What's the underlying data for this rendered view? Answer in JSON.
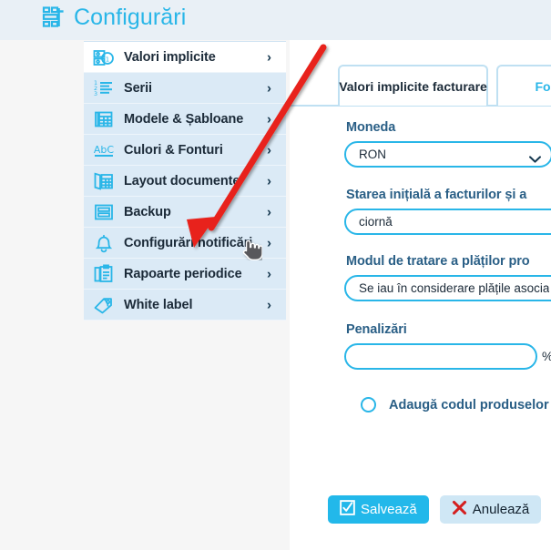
{
  "header": {
    "title": "Configurări",
    "icon": "settings-grid-icon",
    "background": "#e9f0f6",
    "accent": "#29b6e8"
  },
  "sidebar": {
    "items": [
      {
        "label": "Valori implicite",
        "icon": "money-stack-icon",
        "active": true,
        "chevron": "›"
      },
      {
        "label": "Serii",
        "icon": "numbered-list-icon",
        "active": false,
        "chevron": "›"
      },
      {
        "label": "Modele & Șabloane",
        "icon": "templates-icon",
        "active": false,
        "chevron": "›"
      },
      {
        "label": "Culori & Fonturi",
        "icon": "abc-font-icon",
        "active": false,
        "chevron": "›"
      },
      {
        "label": "Layout documente",
        "icon": "document-layout-icon",
        "active": false,
        "chevron": "›"
      },
      {
        "label": "Backup",
        "icon": "backup-drive-icon",
        "active": false,
        "chevron": "›"
      },
      {
        "label": "Configurări notificări",
        "icon": "bell-icon",
        "active": false,
        "chevron": "›"
      },
      {
        "label": "Rapoarte periodice",
        "icon": "clipboard-icon",
        "active": false,
        "chevron": "›"
      },
      {
        "label": "White label",
        "icon": "tag-label-icon",
        "active": false,
        "chevron": "›"
      }
    ]
  },
  "main": {
    "tabs": [
      {
        "label": "Valori implicite facturare",
        "active": true
      },
      {
        "label": "Form",
        "active": false
      }
    ],
    "fields": [
      {
        "label": "Moneda",
        "value": "RON",
        "type": "select",
        "icon": "chevron-down-icon"
      },
      {
        "label": "Starea inițială a facturilor și a",
        "value": "ciornă",
        "type": "select"
      },
      {
        "label": "Modul de tratare a plăților pro",
        "value": "Se iau în considerare plățile asocia",
        "type": "select"
      },
      {
        "label": "Penalizări",
        "value": "",
        "type": "text",
        "suffix": "%"
      }
    ],
    "radio": {
      "label": "Adaugă codul produselor",
      "checked": false
    },
    "buttons": [
      {
        "label": "Salvează",
        "icon": "checkbox-check-icon",
        "kind": "primary"
      },
      {
        "label": "Anulează",
        "icon": "x-mark-icon",
        "kind": "secondary"
      }
    ]
  },
  "annotation": {
    "arrow_color": "#e8231a",
    "cursor": "pointing-hand-cursor"
  }
}
